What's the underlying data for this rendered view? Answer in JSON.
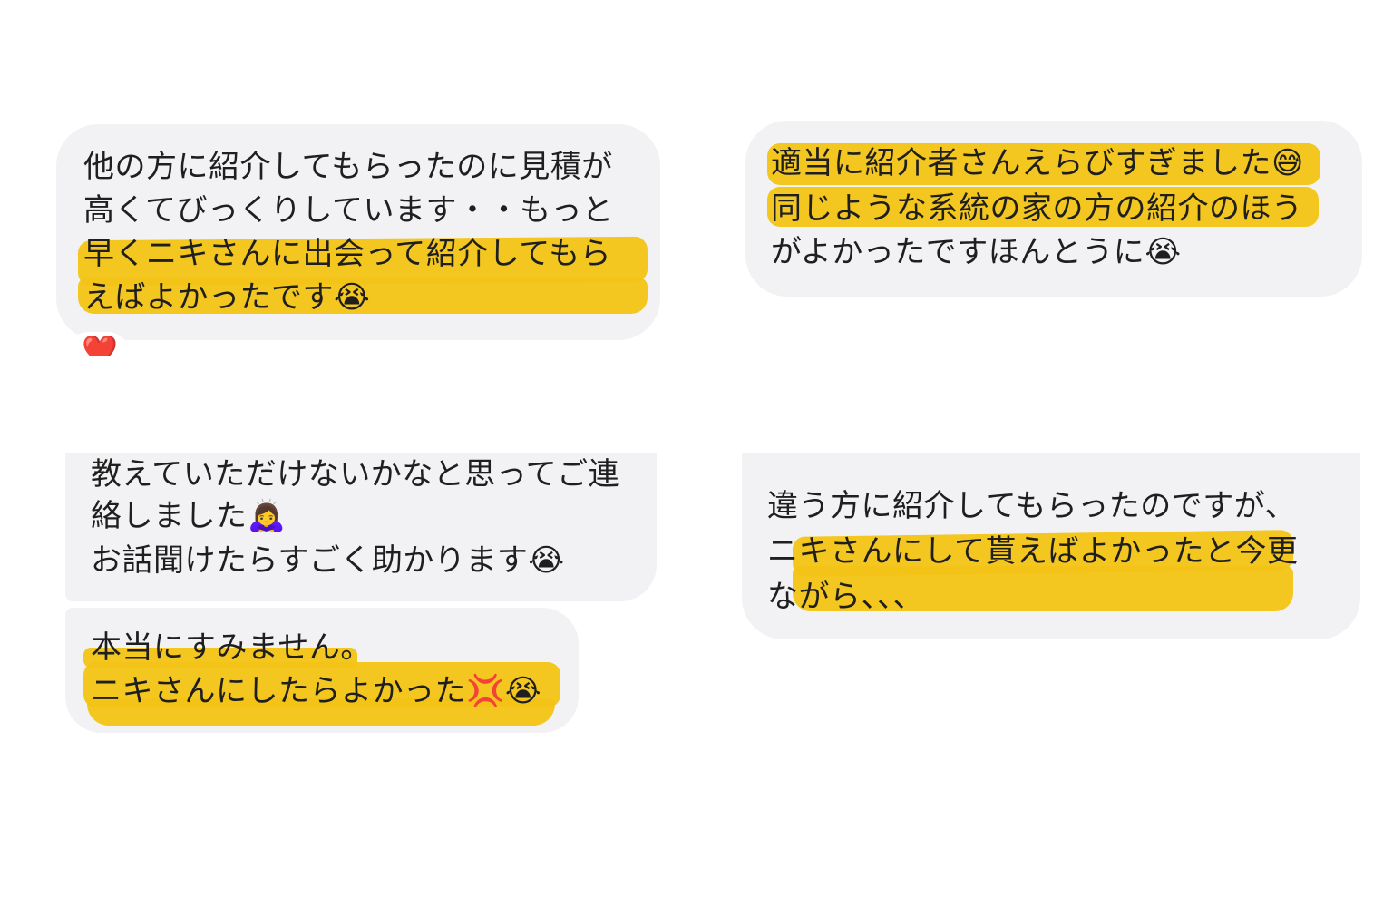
{
  "messages": [
    {
      "lines": [
        "他の方に紹介してもらったのに見積が",
        "高くてびっくりしています・・もっと",
        "早くニキさんに出会って紹介してもら",
        "えばよかったです"
      ],
      "emoji": "😭",
      "reaction": "❤️"
    },
    {
      "lines": [
        "適当に紹介者さんえらびすぎました",
        "同じような系統の家の方の紹介のほう",
        "がよかったですほんとうに"
      ],
      "emoji_line1": "😅",
      "emoji_line3": "😭"
    },
    {
      "lines": [
        "教えていただけないかなと思ってご連",
        "絡しました",
        "お話聞けたらすごく助かります"
      ],
      "emoji_line2": "🙇‍♀️",
      "emoji_line3": "😭"
    },
    {
      "lines": [
        "本当にすみません。",
        "ニキさんにしたらよかった"
      ],
      "emoji_anger": "💢",
      "emoji_cry": "😭"
    },
    {
      "lines": [
        "違う方に紹介してもらったのですが、",
        "ニキさんにして貰えばよかったと今更",
        "ながら、、、"
      ]
    }
  ],
  "colors": {
    "bubble": "#f2f2f4",
    "highlight": "#f3c417",
    "text": "#1f1f1f"
  }
}
